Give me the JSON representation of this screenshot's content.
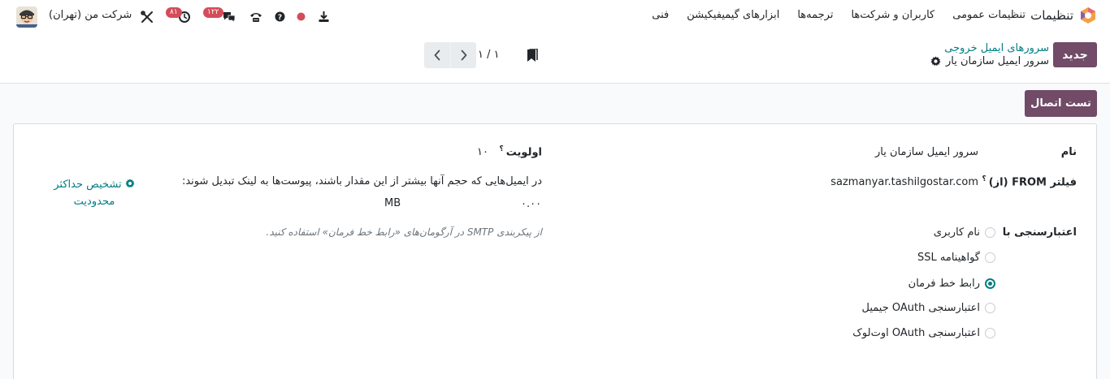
{
  "navbar": {
    "app_title": "تنظیمات",
    "menu": [
      "تنظیمات عمومی",
      "کاربران و شرکت‌ها",
      "ترجمه‌ها",
      "ابزارهای گیمیفیکیشن",
      "فنی"
    ],
    "company": "شرکت من (تهران)",
    "activity_badge": "۸۱",
    "messages_badge": "۱۲۲",
    "colors": {
      "badge": "#d44c59",
      "status_dot": "#d44c59"
    },
    "icons": [
      "tools-icon",
      "clock-icon",
      "chat-icon",
      "phone-icon",
      "help-icon",
      "status-dot-icon",
      "download-icon"
    ]
  },
  "control_panel": {
    "new_button": "جدید",
    "breadcrumb_parent": "سرورهای ایمیل خروجی",
    "breadcrumb_current": "سرور ایمیل سازمان یار",
    "pager_counter": "۱ / ۱"
  },
  "status_bar": {
    "test_button": "تست اتصال"
  },
  "form": {
    "name_label": "نام",
    "name_value": "سرور ایمیل سازمان یار",
    "from_filter_label": "فیلتر FROM (از)",
    "from_filter_value": "sazmanyar.tashilgostar.com",
    "priority_label": "اولویت",
    "priority_value": "۱۰",
    "attachment_text": "در ایمیل‌هایی که حجم آنها بیشتر از این مقدار باشند، پیوست‌ها به لینک تبدیل شوند:",
    "size_value": "۰.۰۰",
    "size_unit": "MB",
    "detect_limit": "تشخیص حداکثر محدودیت",
    "auth_label": "اعتبارسنجی با",
    "auth_options": [
      "نام کاربری",
      "گواهینامه SSL",
      "رابط خط فرمان",
      "اعتبارسنجی OAuth جیمیل",
      "اعتبارسنجی OAuth اوت‌لوک"
    ],
    "auth_selected": "رابط خط فرمان",
    "cli_note": "از پیکربندی SMTP در آرگومان‌های «رابط خط فرمان» استفاده کنید.",
    "tooltip_marker": "؟"
  },
  "colors": {
    "primary": "#714b67",
    "link": "#017e84",
    "text": "#212529",
    "muted": "#6c757d"
  }
}
